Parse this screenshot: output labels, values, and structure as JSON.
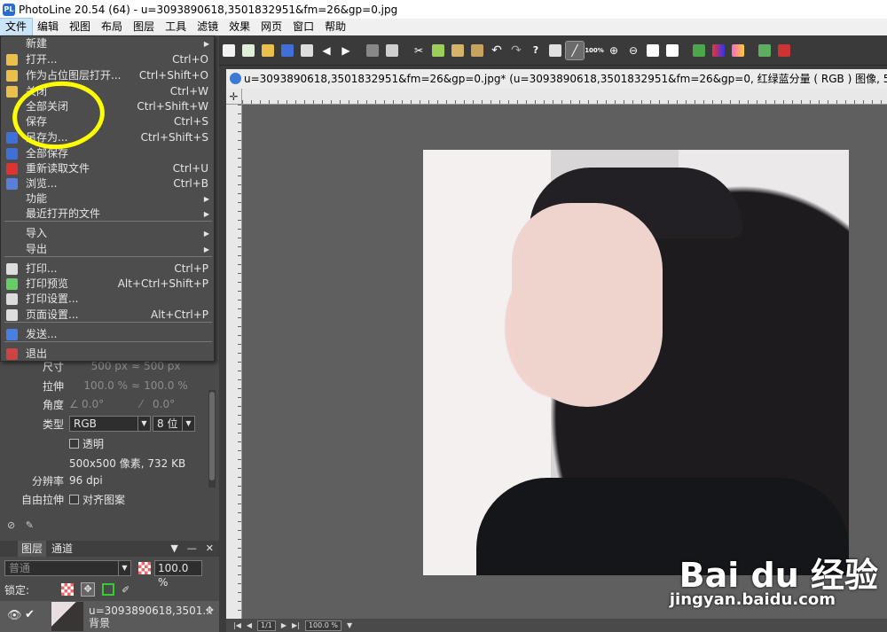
{
  "titlebar": {
    "app_icon_text": "PL",
    "title": "PhotoLine 20.54 (64) - u=3093890618,3501832951&fm=26&gp=0.jpg"
  },
  "menubar": [
    "文件",
    "编辑",
    "视图",
    "布局",
    "图层",
    "工具",
    "滤镜",
    "效果",
    "网页",
    "窗口",
    "帮助"
  ],
  "file_menu": {
    "items": [
      {
        "label": "新建",
        "shortcut": "",
        "submenu": true,
        "icon": ""
      },
      {
        "label": "打开...",
        "shortcut": "Ctrl+O",
        "submenu": false,
        "icon": "folder-open-icon"
      },
      {
        "label": "作为占位图层打开...",
        "shortcut": "Ctrl+Shift+O",
        "submenu": false,
        "icon": "folder-layer-icon"
      },
      {
        "label": "关闭",
        "shortcut": "Ctrl+W",
        "submenu": false,
        "icon": "folder-close-icon"
      },
      {
        "label": "全部关闭",
        "shortcut": "Ctrl+Shift+W",
        "submenu": false,
        "icon": ""
      },
      {
        "label": "保存",
        "shortcut": "Ctrl+S",
        "submenu": false,
        "icon": ""
      },
      {
        "label": "另存为...",
        "shortcut": "Ctrl+Shift+S",
        "submenu": false,
        "icon": "save-as-icon"
      },
      {
        "label": "全部保存",
        "shortcut": "",
        "submenu": false,
        "icon": "save-all-icon"
      },
      {
        "label": "重新读取文件",
        "shortcut": "Ctrl+U",
        "submenu": false,
        "icon": "reload-icon"
      },
      {
        "label": "浏览...",
        "shortcut": "Ctrl+B",
        "submenu": false,
        "icon": "browse-icon"
      },
      {
        "label": "功能",
        "shortcut": "",
        "submenu": true,
        "icon": ""
      },
      {
        "label": "最近打开的文件",
        "shortcut": "",
        "submenu": true,
        "icon": ""
      },
      {
        "label": "导入",
        "shortcut": "",
        "submenu": true,
        "icon": ""
      },
      {
        "label": "导出",
        "shortcut": "",
        "submenu": true,
        "icon": ""
      },
      {
        "label": "打印...",
        "shortcut": "Ctrl+P",
        "submenu": false,
        "icon": "print-icon"
      },
      {
        "label": "打印预览",
        "shortcut": "Alt+Ctrl+Shift+P",
        "submenu": false,
        "icon": "print-preview-icon"
      },
      {
        "label": "打印设置...",
        "shortcut": "",
        "submenu": false,
        "icon": "print-settings-icon"
      },
      {
        "label": "页面设置...",
        "shortcut": "Alt+Ctrl+P",
        "submenu": false,
        "icon": "page-setup-icon"
      },
      {
        "label": "发送...",
        "shortcut": "",
        "submenu": false,
        "icon": "send-icon"
      },
      {
        "label": "退出",
        "shortcut": "",
        "submenu": false,
        "icon": "exit-icon"
      }
    ]
  },
  "properties": {
    "size_label": "尺寸",
    "size_w": "500 px",
    "size_h": "500 px",
    "stretch_label": "拉伸",
    "stretch_w": "100.0 %",
    "stretch_h": "100.0 %",
    "angle_label": "角度",
    "angle_1": "0.0°",
    "angle_2": "0.0°",
    "type_label": "类型",
    "type_value": "RGB",
    "bits_value": "8 位",
    "transparent_label": "透明",
    "info": "500x500 像素, 732 KB",
    "resolution_label": "分辨率",
    "resolution_value": "96 dpi",
    "free_stretch_label": "自由拉伸",
    "align_pattern_label": "对齐图案"
  },
  "layers": {
    "tab_layers": "图层",
    "tab_channels": "通道",
    "blend_mode": "普通",
    "opacity": "100.0 %",
    "lock_label": "锁定:",
    "layer_name": "u=3093890618,3501...",
    "layer_sub": "背景"
  },
  "document": {
    "title": "u=3093890618,3501832951&fm=26&gp=0.jpg* (u=3093890618,3501832951&fm=26&gp=0, 红绿蓝分量 ( RGB ) 图像, 500x500, 10",
    "watermark": "Bai du 经验",
    "watermark_url": "jingyan.baidu.com",
    "page_indicator": "1/1",
    "zoom": "100.0 %"
  },
  "toolbar": {
    "zoom_100_label": "100%"
  },
  "colors": {
    "annotation": "#ffff00",
    "menu_bg": "#4d4d4d",
    "accent": "#2a6bd1"
  }
}
